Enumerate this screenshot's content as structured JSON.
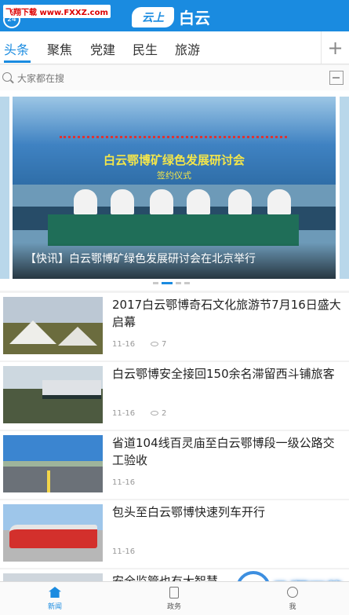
{
  "watermark_top": "飞翔下载 www.FXXZ.com",
  "header": {
    "avatar_text": "24",
    "logo_badge": "云上",
    "logo_text": "白云",
    "accent": "#1a8be0"
  },
  "tabs": [
    {
      "label": "头条",
      "active": true
    },
    {
      "label": "聚焦"
    },
    {
      "label": "党建"
    },
    {
      "label": "民生"
    },
    {
      "label": "旅游"
    }
  ],
  "tab_add_icon": "plus-icon",
  "search": {
    "placeholder": "大家都在搜"
  },
  "carousel": {
    "banner_title": "白云鄂博矿绿色发展研讨会",
    "banner_sub": "签约仪式",
    "caption": "【快讯】白云鄂博矿绿色发展研讨会在北京举行",
    "active_dot": 2,
    "dot_count": 4
  },
  "news": [
    {
      "title": "2017白云鄂博奇石文化旅游节7月16日盛大启幕",
      "date": "11-16",
      "views": "7"
    },
    {
      "title": "白云鄂博安全接回150余名滞留西斗铺旅客",
      "date": "11-16",
      "views": "2"
    },
    {
      "title": "省道104线百灵庙至白云鄂博段一级公路交工验收",
      "date": "11-16",
      "views": ""
    },
    {
      "title": "包头至白云鄂博快速列车开行",
      "date": "11-16",
      "views": ""
    },
    {
      "title": "安全监管也有大智慧",
      "date": "",
      "views": ""
    }
  ],
  "bottom_nav": [
    {
      "label": "新闻",
      "icon": "home-icon",
      "active": true
    },
    {
      "label": "政务",
      "icon": "document-icon"
    },
    {
      "label": "我",
      "icon": "user-icon"
    }
  ],
  "watermark_bottom": "飞翔下载"
}
